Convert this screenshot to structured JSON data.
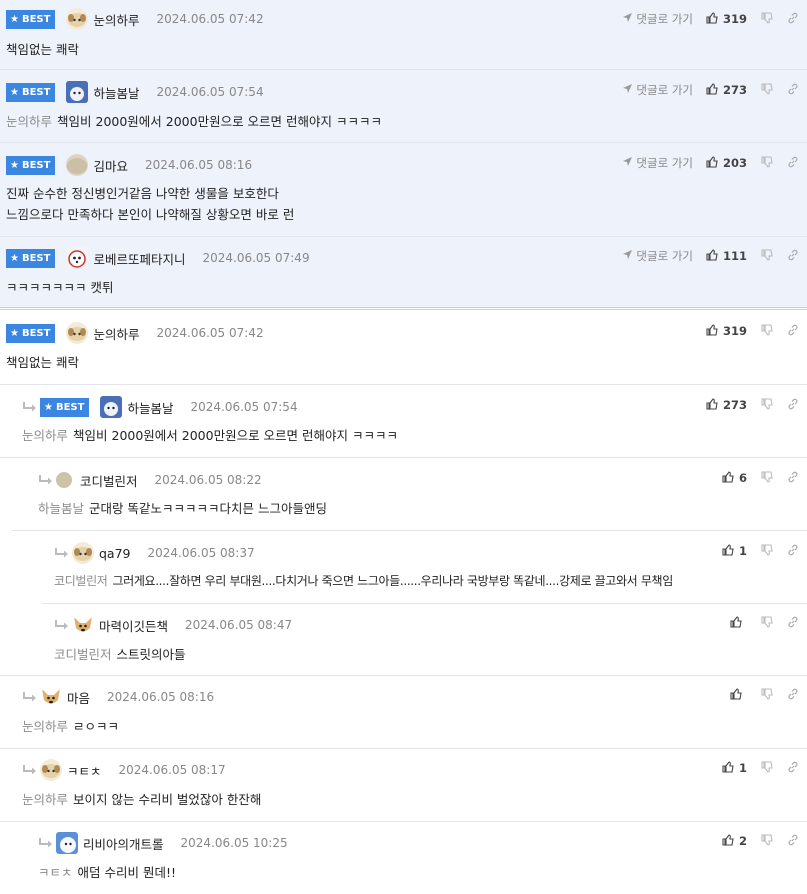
{
  "labels": {
    "best": "BEST",
    "goto": "댓글로 가기"
  },
  "colors": {
    "best_badge": "#3b86e0",
    "best_bg": "#eef2fb",
    "mention": "#8c8c8c"
  },
  "best_comments": [
    {
      "nick": "눈의하루",
      "date": "2024.06.05 07:42",
      "likes": "319",
      "mention": "",
      "lines": [
        "책임없는 쾌락"
      ]
    },
    {
      "nick": "하늘봄날",
      "date": "2024.06.05 07:54",
      "likes": "273",
      "mention": "눈의하루",
      "lines": [
        "책임비 2000원에서 2000만원으로 오르면 런해야지 ㅋㅋㅋㅋ"
      ]
    },
    {
      "nick": "김마요",
      "date": "2024.06.05 08:16",
      "likes": "203",
      "mention": "",
      "lines": [
        "진짜 순수한 정신병인거같음 나약한 생물을 보호한다",
        "느낌으로다 만족하다 본인이 나약해질 상황오면 바로 런"
      ]
    },
    {
      "nick": "로베르또페타지니",
      "date": "2024.06.05 07:49",
      "likes": "111",
      "mention": "",
      "lines": [
        "ㅋㅋㅋㅋㅋㅋㅋ 캣튀"
      ]
    }
  ],
  "thread": [
    {
      "nick": "눈의하루",
      "date": "2024.06.05 07:42",
      "likes": "319",
      "mention": "",
      "text": "책임없는 쾌락"
    },
    {
      "nick": "하늘봄날",
      "date": "2024.06.05 07:54",
      "likes": "273",
      "mention": "눈의하루",
      "text": "책임비 2000원에서 2000만원으로 오르면 런해야지 ㅋㅋㅋㅋ"
    },
    {
      "nick": "코디벌린저",
      "date": "2024.06.05 08:22",
      "likes": "6",
      "mention": "하늘봄날",
      "text": "군대랑 똑같노ㅋㅋㅋㅋㅋ다치믄 느그아들앤딩"
    },
    {
      "nick": "qa79",
      "date": "2024.06.05 08:37",
      "likes": "1",
      "mention": "코디벌린저",
      "text": "그러게요....잘하면 우리 부대원....다치거나 죽으면 느그아들......우리나라 국방부랑 똑같네....강제로 끌고와서 무책임"
    },
    {
      "nick": "마력이깃든책",
      "date": "2024.06.05 08:47",
      "likes": "",
      "mention": "코디벌린저",
      "text": "스트릿의아들"
    },
    {
      "nick": "마음",
      "date": "2024.06.05 08:16",
      "likes": "",
      "mention": "눈의하루",
      "text": "ㄹㅇㅋㅋ"
    },
    {
      "nick": "ㅋㅌㅊ",
      "date": "2024.06.05 08:17",
      "likes": "1",
      "mention": "눈의하루",
      "text": "보이지 않는 수리비 벌었잖아 한잔해"
    },
    {
      "nick": "리비아의개트롤",
      "date": "2024.06.05 10:25",
      "likes": "2",
      "mention": "ㅋㅌㅊ",
      "text": "애덤 수리비 뭔데!!"
    }
  ]
}
